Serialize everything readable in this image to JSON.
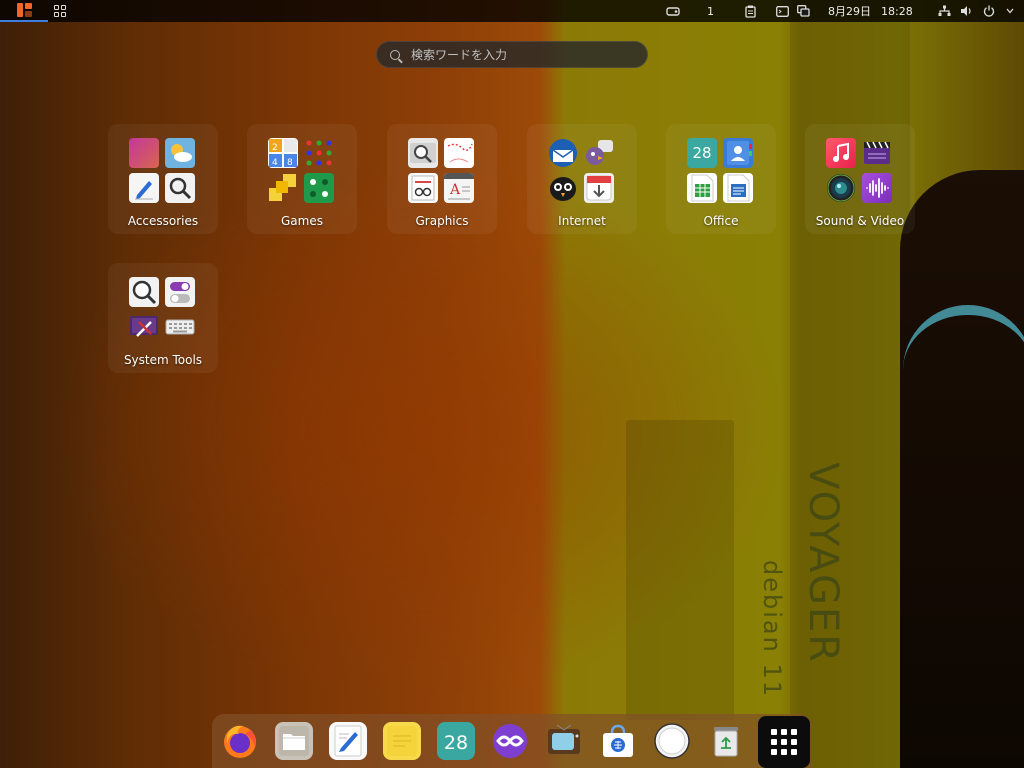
{
  "topbar": {
    "workspace": "1",
    "date": "8月29日",
    "time": "18:28"
  },
  "search": {
    "placeholder": "検索ワードを入力"
  },
  "wallpaper": {
    "brand": "VOYAGER",
    "subtitle": "debian 11"
  },
  "folders": [
    {
      "label": "Accessories",
      "icons": [
        "color-picker-icon",
        "weather-icon",
        "text-editor-icon",
        "search-tool-icon"
      ]
    },
    {
      "label": "Games",
      "icons": [
        "2048-game-icon",
        "atomix-dots-icon",
        "tiles-game-icon",
        "dice-game-icon"
      ]
    },
    {
      "label": "Graphics",
      "icons": [
        "image-viewer-icon",
        "drawing-icon",
        "document-scanner-icon",
        "font-viewer-icon"
      ]
    },
    {
      "label": "Internet",
      "icons": [
        "thunderbird-icon",
        "pidgin-icon",
        "owl-client-icon",
        "downloader-icon"
      ]
    },
    {
      "label": "Office",
      "icons": [
        "calendar-icon",
        "contacts-icon",
        "spreadsheet-icon",
        "writer-icon"
      ]
    },
    {
      "label": "Sound & Video",
      "icons": [
        "music-icon",
        "video-editor-icon",
        "camera-icon",
        "audio-recorder-icon"
      ]
    },
    {
      "label": "System Tools",
      "icons": [
        "disk-search-icon",
        "tweaks-icon",
        "system-settings-icon",
        "keyboard-icon"
      ]
    }
  ],
  "office_calendar_day": "28",
  "dock": {
    "items": [
      "firefox-icon",
      "files-icon",
      "text-editor-icon",
      "notes-icon",
      "calendar-icon",
      "tor-icon",
      "tv-icon",
      "software-icon",
      "screenshot-icon",
      "trash-icon",
      "show-apps-icon"
    ],
    "calendar_day": "28"
  },
  "colors": {
    "accent": "#3d7de0",
    "activities_logo": "#f0652a"
  }
}
